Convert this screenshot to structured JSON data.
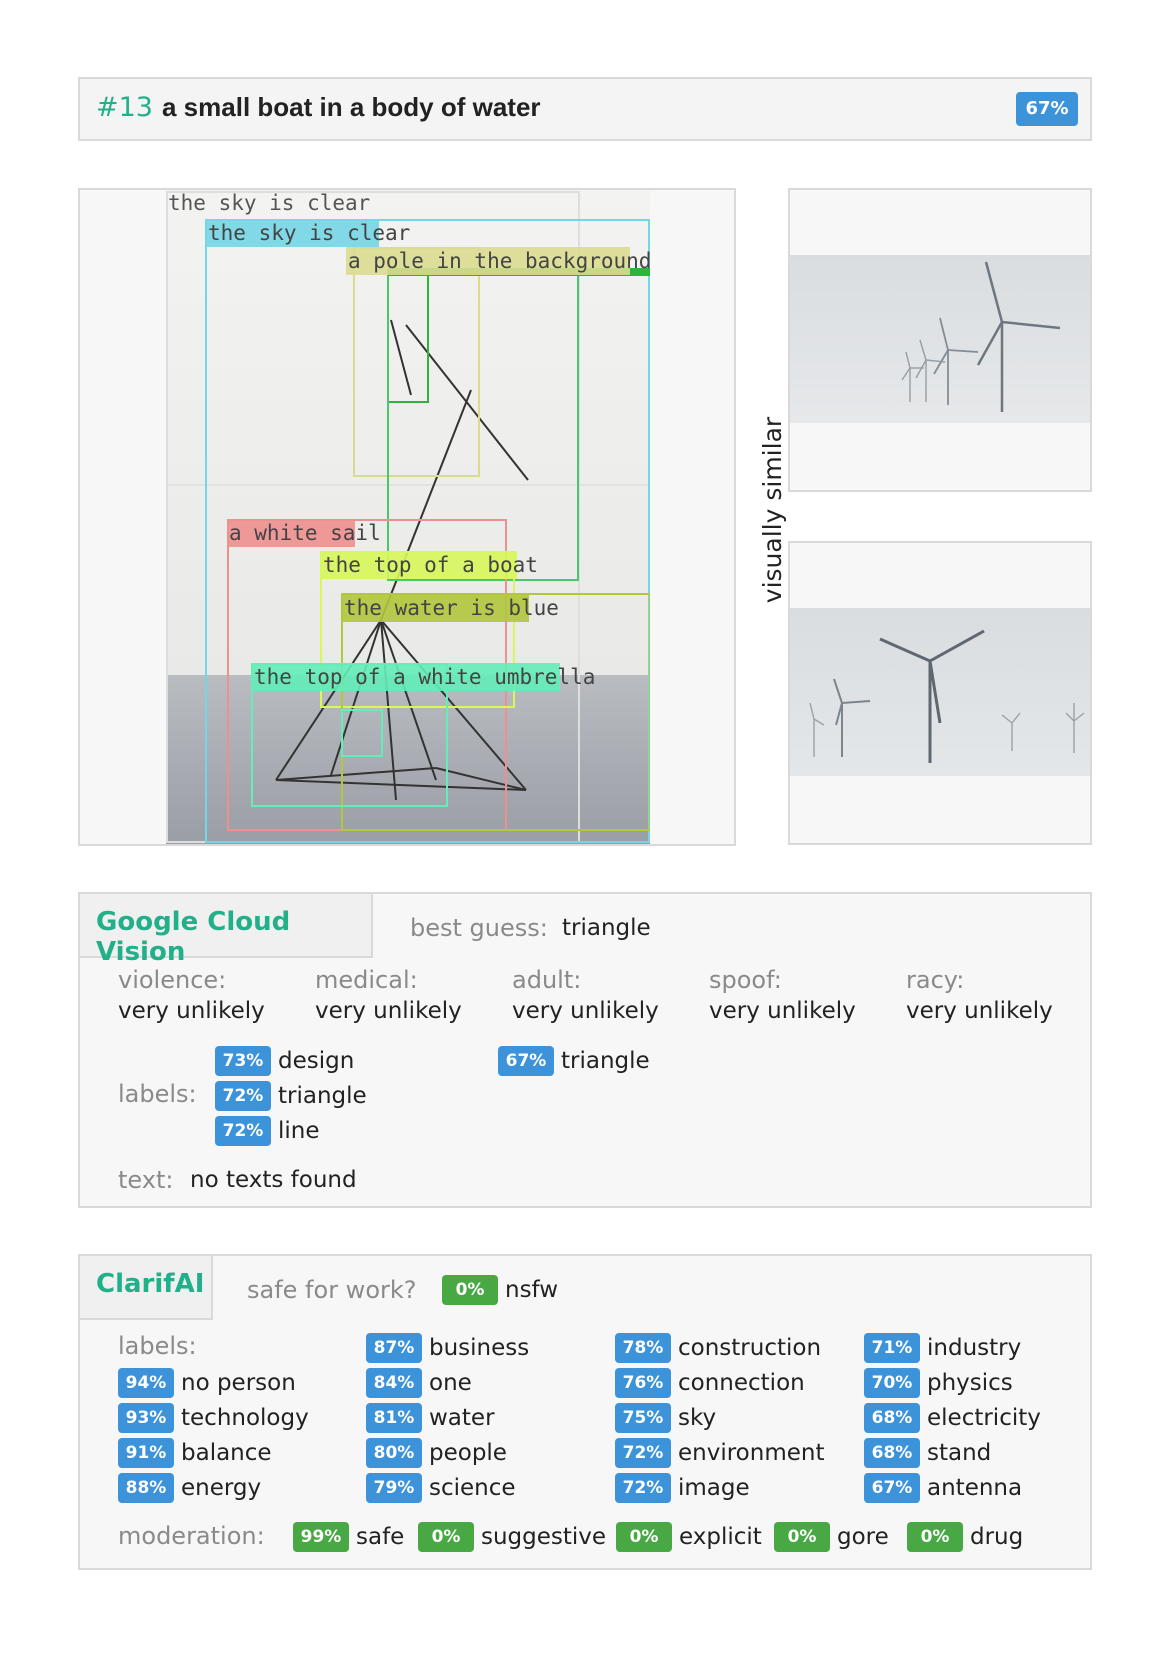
{
  "header": {
    "number": "#13",
    "caption": "a small boat in a body of water",
    "score": "67%"
  },
  "main_image": {
    "boxes": [
      {
        "label": "the sky is clear",
        "color": "#cfcfcf"
      },
      {
        "label": "the sky is clear",
        "color": "#74d6e6"
      },
      {
        "label": "a pole in the background",
        "color": "#d9db8f"
      },
      {
        "label": "a white sail",
        "color": "#f08f8f"
      },
      {
        "label": "the top of a boat",
        "color": "#d7f75b"
      },
      {
        "label": "the water is blue",
        "color": "#b3c73c"
      },
      {
        "label": "the top of a white umbrella",
        "color": "#63edb8"
      }
    ]
  },
  "similar": {
    "label": "visually similar",
    "images": [
      "wind-turbines-fog-1",
      "wind-turbines-fog-2"
    ]
  },
  "gcv": {
    "title": "Google Cloud Vision",
    "best_guess_label": "best guess:",
    "best_guess_value": "triangle",
    "safe_search": [
      {
        "label": "violence:",
        "value": "very unlikely"
      },
      {
        "label": "medical:",
        "value": "very unlikely"
      },
      {
        "label": "adult:",
        "value": "very unlikely"
      },
      {
        "label": "spoof:",
        "value": "very unlikely"
      },
      {
        "label": "racy:",
        "value": "very unlikely"
      }
    ],
    "labels_title": "labels:",
    "labels": [
      {
        "score": "73%",
        "name": "design"
      },
      {
        "score": "72%",
        "name": "triangle"
      },
      {
        "score": "72%",
        "name": "line"
      }
    ],
    "web_entities": [
      {
        "score": "67%",
        "name": "triangle"
      }
    ],
    "text_label": "text:",
    "text_value": "no texts found"
  },
  "clarifai": {
    "title": "ClarifAI",
    "sfw_label": "safe for work?",
    "nsfw_score": "0%",
    "nsfw_label": "nsfw",
    "labels_title": "labels:",
    "columns": [
      [
        {
          "score": "94%",
          "name": "no person"
        },
        {
          "score": "93%",
          "name": "technology"
        },
        {
          "score": "91%",
          "name": "balance"
        },
        {
          "score": "88%",
          "name": "energy"
        }
      ],
      [
        {
          "score": "87%",
          "name": "business"
        },
        {
          "score": "84%",
          "name": "one"
        },
        {
          "score": "81%",
          "name": "water"
        },
        {
          "score": "80%",
          "name": "people"
        },
        {
          "score": "79%",
          "name": "science"
        }
      ],
      [
        {
          "score": "78%",
          "name": "construction"
        },
        {
          "score": "76%",
          "name": "connection"
        },
        {
          "score": "75%",
          "name": "sky"
        },
        {
          "score": "72%",
          "name": "environment"
        },
        {
          "score": "72%",
          "name": "image"
        }
      ],
      [
        {
          "score": "71%",
          "name": "industry"
        },
        {
          "score": "70%",
          "name": "physics"
        },
        {
          "score": "68%",
          "name": "electricity"
        },
        {
          "score": "68%",
          "name": "stand"
        },
        {
          "score": "67%",
          "name": "antenna"
        }
      ]
    ],
    "moderation_label": "moderation:",
    "moderation": [
      {
        "score": "99%",
        "name": "safe"
      },
      {
        "score": "0%",
        "name": "suggestive"
      },
      {
        "score": "0%",
        "name": "explicit"
      },
      {
        "score": "0%",
        "name": "gore"
      },
      {
        "score": "0%",
        "name": "drug"
      }
    ]
  },
  "colors": {
    "accent_teal": "#21b08a",
    "badge_blue": "#3c93da",
    "badge_green": "#48a944"
  }
}
